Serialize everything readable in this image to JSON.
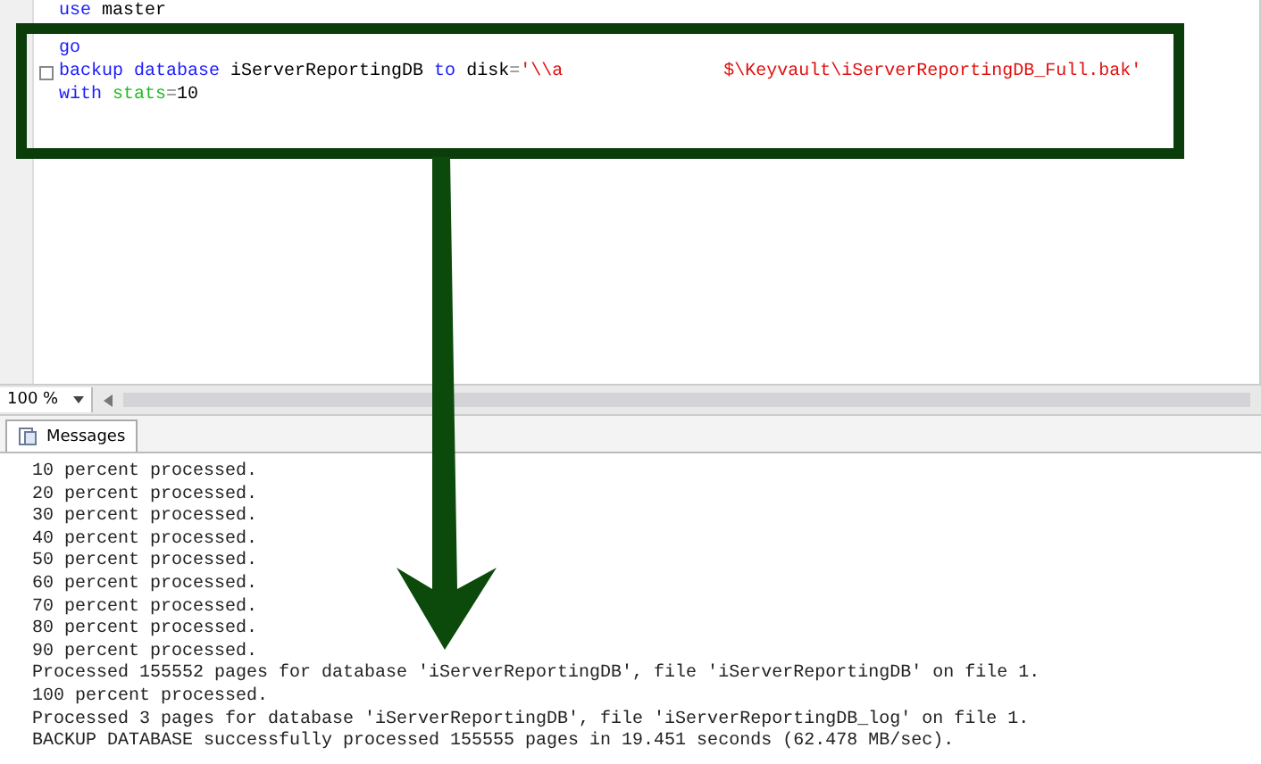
{
  "editor": {
    "lines": [
      {
        "collapsible": false,
        "tokens": [
          {
            "kind": "keyword",
            "text": "use"
          },
          {
            "kind": "plain",
            "text": " master"
          }
        ]
      },
      {
        "collapsible": false,
        "tokens": [
          {
            "kind": "keyword",
            "text": "go"
          }
        ]
      },
      {
        "collapsible": true,
        "tokens": [
          {
            "kind": "keyword",
            "text": "backup database"
          },
          {
            "kind": "plain",
            "text": " iServerReportingDB "
          },
          {
            "kind": "keyword",
            "text": "to"
          },
          {
            "kind": "plain",
            "text": " disk"
          },
          {
            "kind": "operator",
            "text": "="
          },
          {
            "kind": "string",
            "text": "'\\\\a"
          },
          {
            "kind": "gap"
          },
          {
            "kind": "string",
            "text": "$\\Keyvault\\iServerReportingDB_Full.bak'"
          }
        ]
      },
      {
        "collapsible": false,
        "tokens": [
          {
            "kind": "keyword",
            "text": "with "
          },
          {
            "kind": "function",
            "text": "stats"
          },
          {
            "kind": "operator",
            "text": "="
          },
          {
            "kind": "plain",
            "text": "10"
          }
        ]
      }
    ]
  },
  "zoom": {
    "value": "100 %"
  },
  "tabs": [
    {
      "label": "Messages",
      "selected": true
    }
  ],
  "messages": [
    "10 percent processed.",
    "20 percent processed.",
    "30 percent processed.",
    "40 percent processed.",
    "50 percent processed.",
    "60 percent processed.",
    "70 percent processed.",
    "80 percent processed.",
    "90 percent processed.",
    "Processed 155552 pages for database 'iServerReportingDB', file 'iServerReportingDB' on file 1.",
    "100 percent processed.",
    "Processed 3 pages for database 'iServerReportingDB', file 'iServerReportingDB_log' on file 1.",
    "BACKUP DATABASE successfully processed 155555 pages in 19.451 seconds (62.478 MB/sec)."
  ]
}
